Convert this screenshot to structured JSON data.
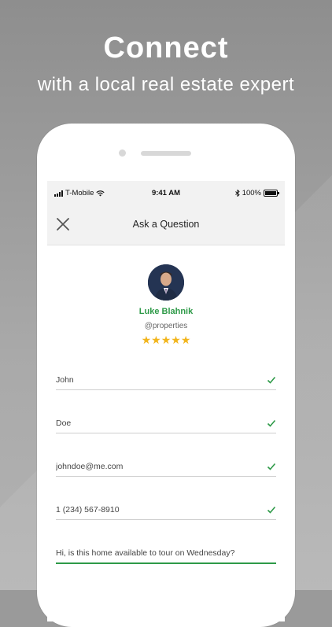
{
  "marketing": {
    "headline": "Connect",
    "subline": "with a local real estate expert"
  },
  "status_bar": {
    "carrier": "T-Mobile",
    "time": "9:41 AM",
    "battery": "100%"
  },
  "nav": {
    "title": "Ask a Question",
    "close_icon": "close-icon"
  },
  "agent": {
    "name": "Luke Blahnik",
    "handle": "@properties",
    "rating": 5,
    "stars_text": "★★★★★"
  },
  "form": {
    "first_name": "John",
    "last_name": "Doe",
    "email": "johndoe@me.com",
    "phone": "1 (234) 567-8910",
    "message": "Hi, is this home available to tour on Wednesday?"
  },
  "colors": {
    "accent": "#2e9a48",
    "star": "#f2b51c"
  }
}
